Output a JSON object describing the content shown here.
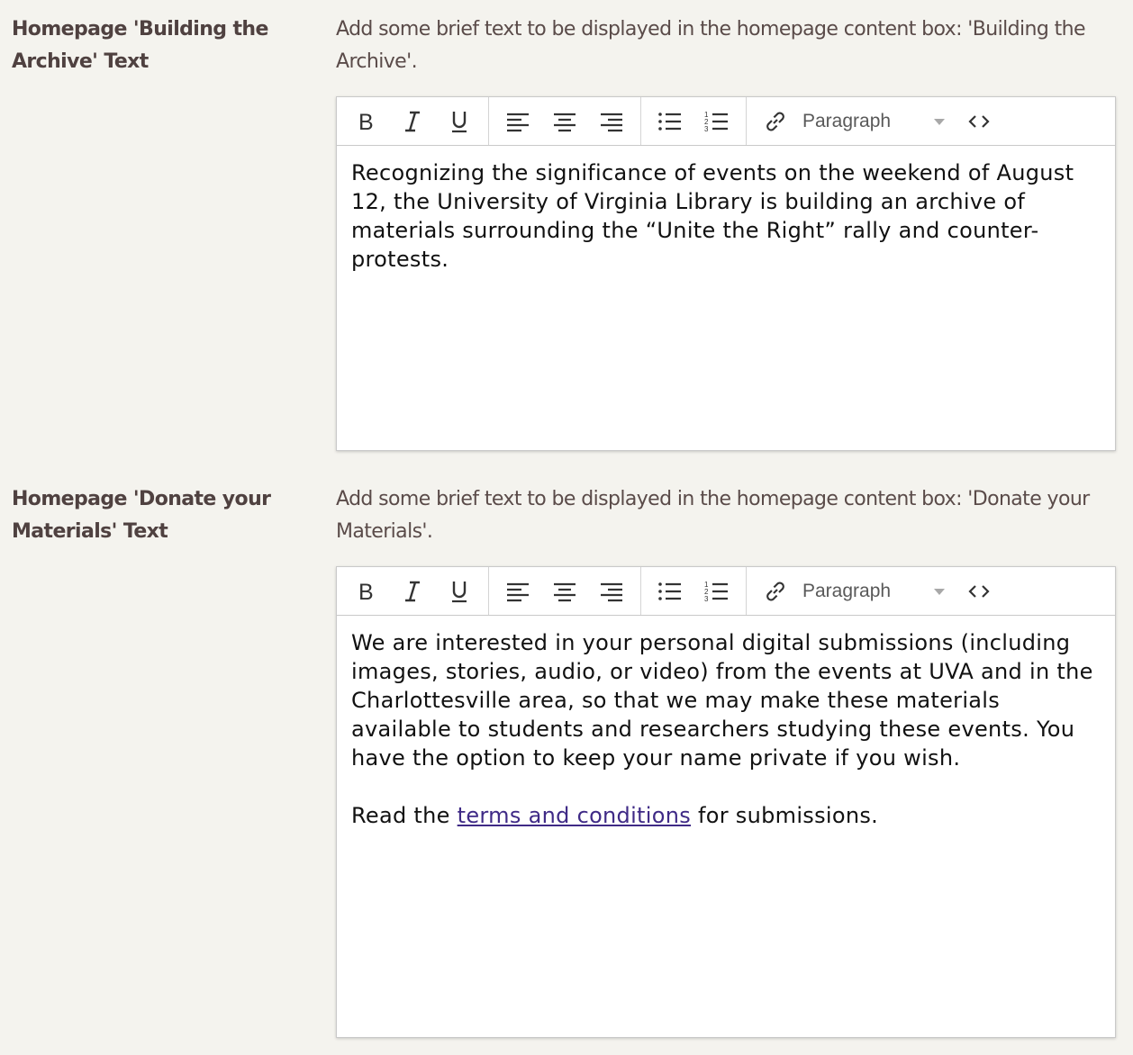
{
  "fields": [
    {
      "label": "Homepage 'Building the Archive' Text",
      "description": "Add some brief text to be displayed in the homepage content box: 'Building the Archive'.",
      "format_label": "Paragraph",
      "content": {
        "paragraph1": "Recognizing the significance of events on the weekend of August 12, the University of Virginia Library is building an archive of materials surrounding the “Unite the Right” rally and counter-protests."
      }
    },
    {
      "label": "Homepage 'Donate your Materials' Text",
      "description": "Add some brief text to be displayed in the homepage content box: 'Donate your Materials'.",
      "format_label": "Paragraph",
      "content": {
        "paragraph1": "We are interested in your personal digital submissions (including images, stories, audio, or video) from the events at UVA and in the Charlottesville area, so that we may make these materials available to students and researchers studying these events. You have the option to keep your name private if you wish.",
        "p2_before": "Read the ",
        "p2_link": "terms and conditions",
        "p2_after": " for submissions."
      }
    }
  ],
  "toolbar_icons": [
    "bold-icon",
    "italic-icon",
    "underline-icon",
    "align-left-icon",
    "align-center-icon",
    "align-right-icon",
    "bulleted-list-icon",
    "numbered-list-icon",
    "link-icon",
    "format-dropdown",
    "source-code-icon"
  ],
  "colors": {
    "background": "#f4f3ee",
    "label": "#4f4140",
    "link": "#3f2a86"
  }
}
